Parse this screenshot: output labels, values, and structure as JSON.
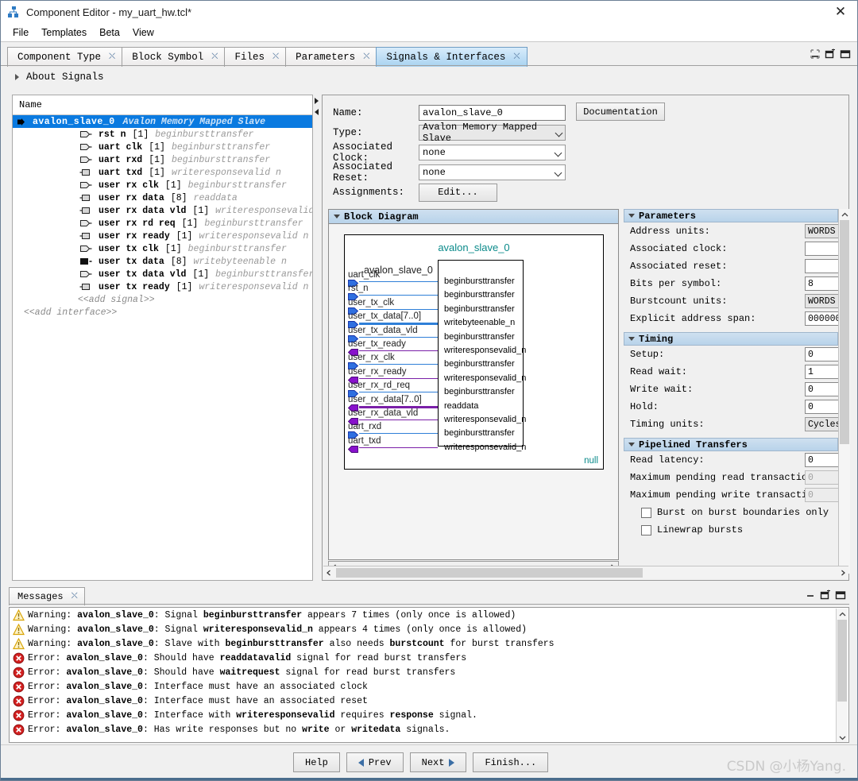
{
  "window": {
    "title": "Component Editor - my_uart_hw.tcl*",
    "app_icon": "component-editor-icon",
    "close_icon": "✕"
  },
  "menubar": {
    "items": [
      {
        "label": "File"
      },
      {
        "label": "Templates"
      },
      {
        "label": "Beta"
      },
      {
        "label": "View"
      }
    ]
  },
  "tabs": [
    {
      "label": "Component Type",
      "active": false
    },
    {
      "label": "Block Symbol",
      "active": false
    },
    {
      "label": "Files",
      "active": false
    },
    {
      "label": "Parameters",
      "active": false
    },
    {
      "label": "Signals & Interfaces",
      "active": true
    }
  ],
  "panel_buttons": [
    {
      "name": "minimize-panel-icon"
    },
    {
      "name": "float-panel-icon"
    },
    {
      "name": "maximize-panel-icon"
    }
  ],
  "about": {
    "label": "About Signals"
  },
  "tree": {
    "header": "Name",
    "interface": {
      "name": "avalon_slave_0",
      "type": "Avalon Memory Mapped Slave",
      "selected": true
    },
    "signals": [
      {
        "dir": "input",
        "name": "rst_n",
        "width": "[1]",
        "role": "beginbursttransfer"
      },
      {
        "dir": "input",
        "name": "uart_clk",
        "width": "[1]",
        "role": "beginbursttransfer"
      },
      {
        "dir": "input",
        "name": "uart_rxd",
        "width": "[1]",
        "role": "beginbursttransfer"
      },
      {
        "dir": "output",
        "name": "uart_txd",
        "width": "[1]",
        "role": "writeresponsevalid_n"
      },
      {
        "dir": "input",
        "name": "user_rx_clk",
        "width": "[1]",
        "role": "beginbursttransfer"
      },
      {
        "dir": "output",
        "name": "user_rx_data",
        "width": "[8]",
        "role": "readdata"
      },
      {
        "dir": "output",
        "name": "user_rx_data_vld",
        "width": "[1]",
        "role": "writeresponsevalid_n"
      },
      {
        "dir": "input",
        "name": "user_rx_rd_req",
        "width": "[1]",
        "role": "beginbursttransfer"
      },
      {
        "dir": "output",
        "name": "user_rx_ready",
        "width": "[1]",
        "role": "writeresponsevalid_n"
      },
      {
        "dir": "input",
        "name": "user_tx_clk",
        "width": "[1]",
        "role": "beginbursttransfer"
      },
      {
        "dir": "output",
        "name": "user_tx_data",
        "width": "[8]",
        "role": "writebyteenable_n"
      },
      {
        "dir": "input",
        "name": "user_tx_data_vld",
        "width": "[1]",
        "role": "beginbursttransfer"
      },
      {
        "dir": "output",
        "name": "user_tx_ready",
        "width": "[1]",
        "role": "writeresponsevalid_n"
      }
    ],
    "add_signal": "<<add signal>>",
    "add_interface": "<<add interface>>"
  },
  "properties": {
    "name_label": "Name:",
    "name_value": "avalon_slave_0",
    "type_label": "Type:",
    "type_value": "Avalon Memory Mapped Slave",
    "assoc_clock_label": "Associated Clock:",
    "assoc_clock_value": "none",
    "assoc_reset_label": "Associated Reset:",
    "assoc_reset_value": "none",
    "assignments_label": "Assignments:",
    "edit_button": "Edit...",
    "documentation_button": "Documentation"
  },
  "block_diagram": {
    "section_title": "Block Diagram",
    "heading": "avalon_slave_0",
    "sub_label": "avalon_slave_0",
    "null_label": "null",
    "colors": {
      "input_line": "#2f7fd8",
      "output_line": "#7a1fa8",
      "heading": "#0a8a8a"
    },
    "ports": [
      {
        "label": "uart_clk",
        "dir": "input",
        "role": "beginbursttransfer"
      },
      {
        "label": "rst_n",
        "dir": "input",
        "role": "beginbursttransfer"
      },
      {
        "label": "user_tx_clk",
        "dir": "input",
        "role": "beginbursttransfer"
      },
      {
        "label": "user_tx_data[7..0]",
        "dir": "input",
        "role": "writebyteenable_n",
        "bus": true
      },
      {
        "label": "user_tx_data_vld",
        "dir": "input",
        "role": "beginbursttransfer"
      },
      {
        "label": "user_tx_ready",
        "dir": "output",
        "role": "writeresponsevalid_n"
      },
      {
        "label": "user_rx_clk",
        "dir": "input",
        "role": "beginbursttransfer"
      },
      {
        "label": "user_rx_ready",
        "dir": "output",
        "role": "writeresponsevalid_n"
      },
      {
        "label": "user_rx_rd_req",
        "dir": "input",
        "role": "beginbursttransfer"
      },
      {
        "label": "user_rx_data[7..0]",
        "dir": "output",
        "role": "readdata",
        "bus": true
      },
      {
        "label": "user_rx_data_vld",
        "dir": "output",
        "role": "writeresponsevalid_n"
      },
      {
        "label": "uart_rxd",
        "dir": "input",
        "role": "beginbursttransfer"
      },
      {
        "label": "uart_txd",
        "dir": "output",
        "role": "writeresponsevalid_n"
      }
    ]
  },
  "parameters_section": {
    "title": "Parameters",
    "rows": [
      {
        "label": "Address units:",
        "value": "WORDS",
        "kind": "combo"
      },
      {
        "label": "Associated clock:",
        "value": "",
        "kind": "text"
      },
      {
        "label": "Associated reset:",
        "value": "",
        "kind": "text"
      },
      {
        "label": "Bits per symbol:",
        "value": "8",
        "kind": "text"
      },
      {
        "label": "Burstcount units:",
        "value": "WORDS",
        "kind": "combo"
      },
      {
        "label": "Explicit address span:",
        "value": "000000",
        "kind": "text"
      }
    ]
  },
  "timing_section": {
    "title": "Timing",
    "rows": [
      {
        "label": "Setup:",
        "value": "0",
        "kind": "text"
      },
      {
        "label": "Read wait:",
        "value": "1",
        "kind": "text"
      },
      {
        "label": "Write wait:",
        "value": "0",
        "kind": "text"
      },
      {
        "label": "Hold:",
        "value": "0",
        "kind": "text"
      },
      {
        "label": "Timing units:",
        "value": "Cycles",
        "kind": "combo"
      }
    ]
  },
  "pipelined_section": {
    "title": "Pipelined Transfers",
    "rows": [
      {
        "label": "Read latency:",
        "value": "0",
        "kind": "text"
      },
      {
        "label": "Maximum pending read transactions:",
        "value": "0",
        "kind": "disabled"
      },
      {
        "label": "Maximum pending write transactions:",
        "value": "0",
        "kind": "disabled"
      }
    ],
    "checkboxes": [
      {
        "label": "Burst on burst boundaries only",
        "checked": false
      },
      {
        "label": "Linewrap bursts",
        "checked": false
      }
    ]
  },
  "messages": {
    "tab_label": "Messages",
    "panel_buttons": [
      {
        "name": "minimize-panel-icon"
      },
      {
        "name": "float-panel-icon"
      },
      {
        "name": "maximize-panel-icon"
      }
    ],
    "rows": [
      {
        "severity": "warning",
        "html": "Warning: <b>avalon_slave_0</b>: Signal <b>beginbursttransfer</b> appears 7 times (only once is allowed)"
      },
      {
        "severity": "warning",
        "html": "Warning: <b>avalon_slave_0</b>: Signal <b>writeresponsevalid_n</b> appears 4 times (only once is allowed)"
      },
      {
        "severity": "warning",
        "html": "Warning: <b>avalon_slave_0</b>: Slave with <b>beginbursttransfer</b> also needs <b>burstcount</b> for burst transfers"
      },
      {
        "severity": "error",
        "html": "Error: <b>avalon_slave_0</b>: Should have <b>readdatavalid</b> signal for read burst transfers"
      },
      {
        "severity": "error",
        "html": "Error: <b>avalon_slave_0</b>: Should have <b>waitrequest</b> signal for read burst transfers"
      },
      {
        "severity": "error",
        "html": "Error: <b>avalon_slave_0</b>: Interface must have an associated clock"
      },
      {
        "severity": "error",
        "html": "Error: <b>avalon_slave_0</b>: Interface must have an associated reset"
      },
      {
        "severity": "error",
        "html": "Error: <b>avalon_slave_0</b>: Interface with <b>writeresponsevalid</b> requires <b>response</b> signal."
      },
      {
        "severity": "error",
        "html": "Error: <b>avalon_slave_0</b>: Has write responses but no <b>write</b> or <b>writedata</b> signals."
      }
    ]
  },
  "footer": {
    "buttons": [
      {
        "label": "Help",
        "arrow": "none"
      },
      {
        "label": "Prev",
        "arrow": "left"
      },
      {
        "label": "Next",
        "arrow": "right"
      },
      {
        "label": "Finish...",
        "arrow": "none"
      }
    ],
    "watermark": "CSDN @小杨Yang."
  }
}
